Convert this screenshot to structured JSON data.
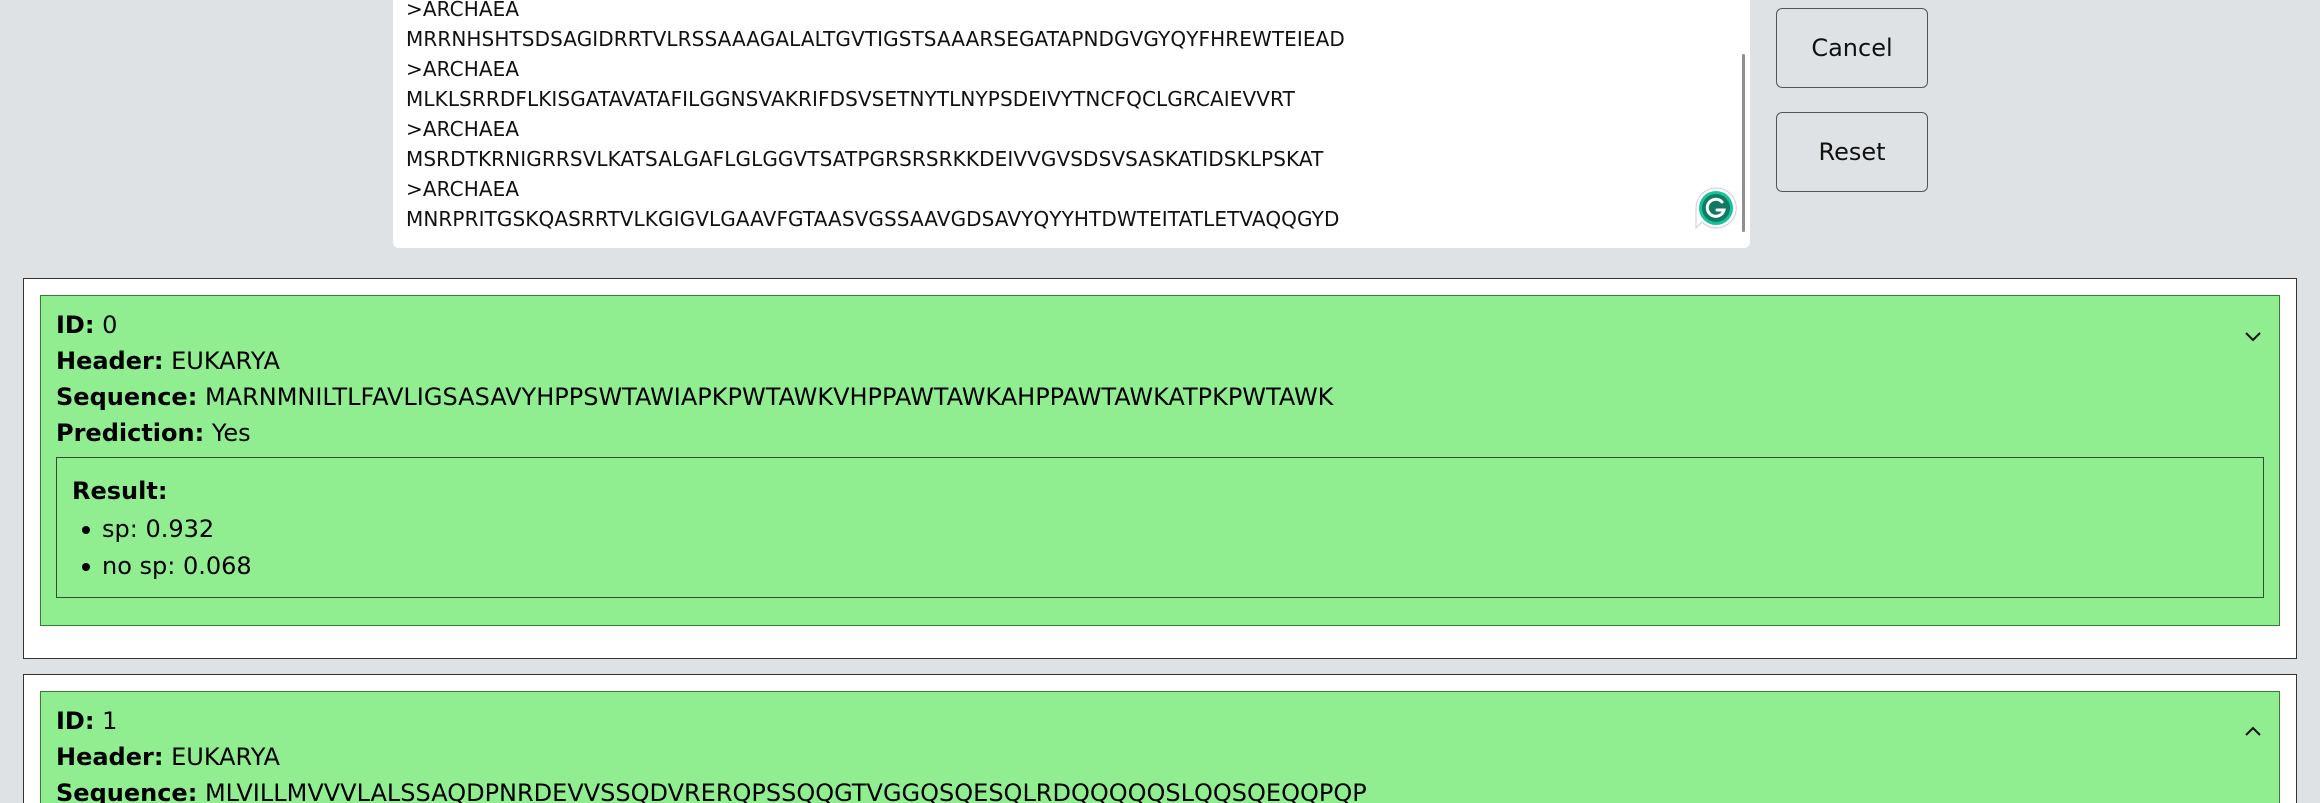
{
  "input": {
    "lines": [
      ">ARCHAEA",
      "MRRNHSHTSDSAGIDRRTVLRSSAAAGALALTGVTIGSTSAAARSEGATAPNDGVGYQYFHREWTEIEAD",
      ">ARCHAEA",
      "MLKLSRRDFLKISGATAVATAFILGGNSVAKRIFDSVSETNYTLNYPSDEIVYTNCFQCLGRCAIEVVRT",
      ">ARCHAEA",
      "MSRDTKRNIGRRSVLKATSALGAFLGLGGVTSATPGRSRSRKKDEIVVGVSDSVSASKATIDSKLPSKAT",
      ">ARCHAEA",
      "MNRPRITGSKQASRRTVLKGIGVLGAAVFGTAASVGSSAAVGDSAVYQYYHTDWTEITATLETVAQQGYD"
    ]
  },
  "buttons": {
    "cancel": "Cancel",
    "reset": "Reset"
  },
  "labels": {
    "id": "ID:",
    "header": "Header:",
    "sequence": "Sequence:",
    "prediction": "Prediction:",
    "result": "Result:"
  },
  "results": [
    {
      "id": "0",
      "header": "EUKARYA",
      "sequence": "MARNMNILTLFAVLIGSASAVYHPPSWTAWIAPKPWTAWKVHPPAWTAWKAHPPAWTAWKATPKPWTAWK",
      "prediction": "Yes",
      "result": [
        "sp: 0.932",
        "no sp: 0.068"
      ]
    },
    {
      "id": "1",
      "header": "EUKARYA",
      "sequence": "MLVILLMVVVLALSSAQDPNRDEVVSSQDVRERQPSSQQGTVGGQSQESQLRDQQQQQSLQQSQEQQPQP"
    }
  ],
  "colors": {
    "card_bg": "#90ee90",
    "page_bg": "#dfe2e4",
    "grammarly": "#15c39a"
  },
  "icons": {
    "grammarly": "grammarly-icon",
    "collapse": "chevron-down-icon",
    "expand": "chevron-up-icon"
  }
}
